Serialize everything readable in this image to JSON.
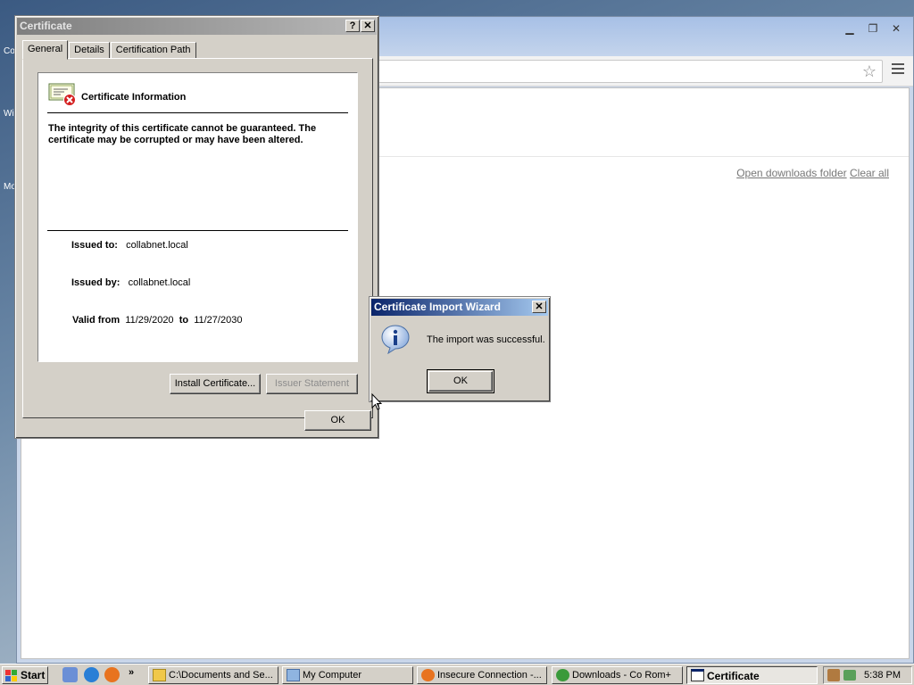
{
  "desktop": {
    "labels": [
      "Co",
      "Wi",
      "Mo"
    ]
  },
  "browser": {
    "controls": {
      "minimize": "▁",
      "restore": "❐",
      "close": "✕"
    },
    "downloads": {
      "open_folder": "Open downloads folder",
      "clear_all": "Clear all"
    }
  },
  "certificate_dialog": {
    "title": "Certificate",
    "help_btn": "?",
    "close_btn": "✕",
    "tabs": [
      {
        "label": "General",
        "active": true
      },
      {
        "label": "Details",
        "active": false
      },
      {
        "label": "Certification Path",
        "active": false
      }
    ],
    "header": "Certificate Information",
    "message": "The integrity of this certificate cannot be guaranteed. The certificate may be corrupted or may have been altered.",
    "issued_to_label": "Issued to:",
    "issued_to": "collabnet.local",
    "issued_by_label": "Issued by:",
    "issued_by": "collabnet.local",
    "valid_from_label": "Valid from",
    "valid_from": "11/29/2020",
    "valid_to_label": "to",
    "valid_to": "11/27/2030",
    "install_btn": "Install Certificate...",
    "issuer_btn": "Issuer Statement",
    "ok_btn": "OK"
  },
  "import_wizard": {
    "title": "Certificate Import Wizard",
    "close_btn": "✕",
    "message": "The import was successful.",
    "ok_btn": "OK"
  },
  "taskbar": {
    "start": "Start",
    "chevron": "»",
    "tasks": [
      {
        "label": "C:\\Documents and Se...",
        "icon": "folder-icon"
      },
      {
        "label": "My Computer",
        "icon": "computer-icon"
      },
      {
        "label": "Insecure Connection -...",
        "icon": "firefox-icon"
      },
      {
        "label": "Downloads - Co Rom+",
        "icon": "chrome-icon"
      },
      {
        "label": "Certificate",
        "icon": "window-icon",
        "active": true
      }
    ],
    "clock": "5:38 PM"
  }
}
